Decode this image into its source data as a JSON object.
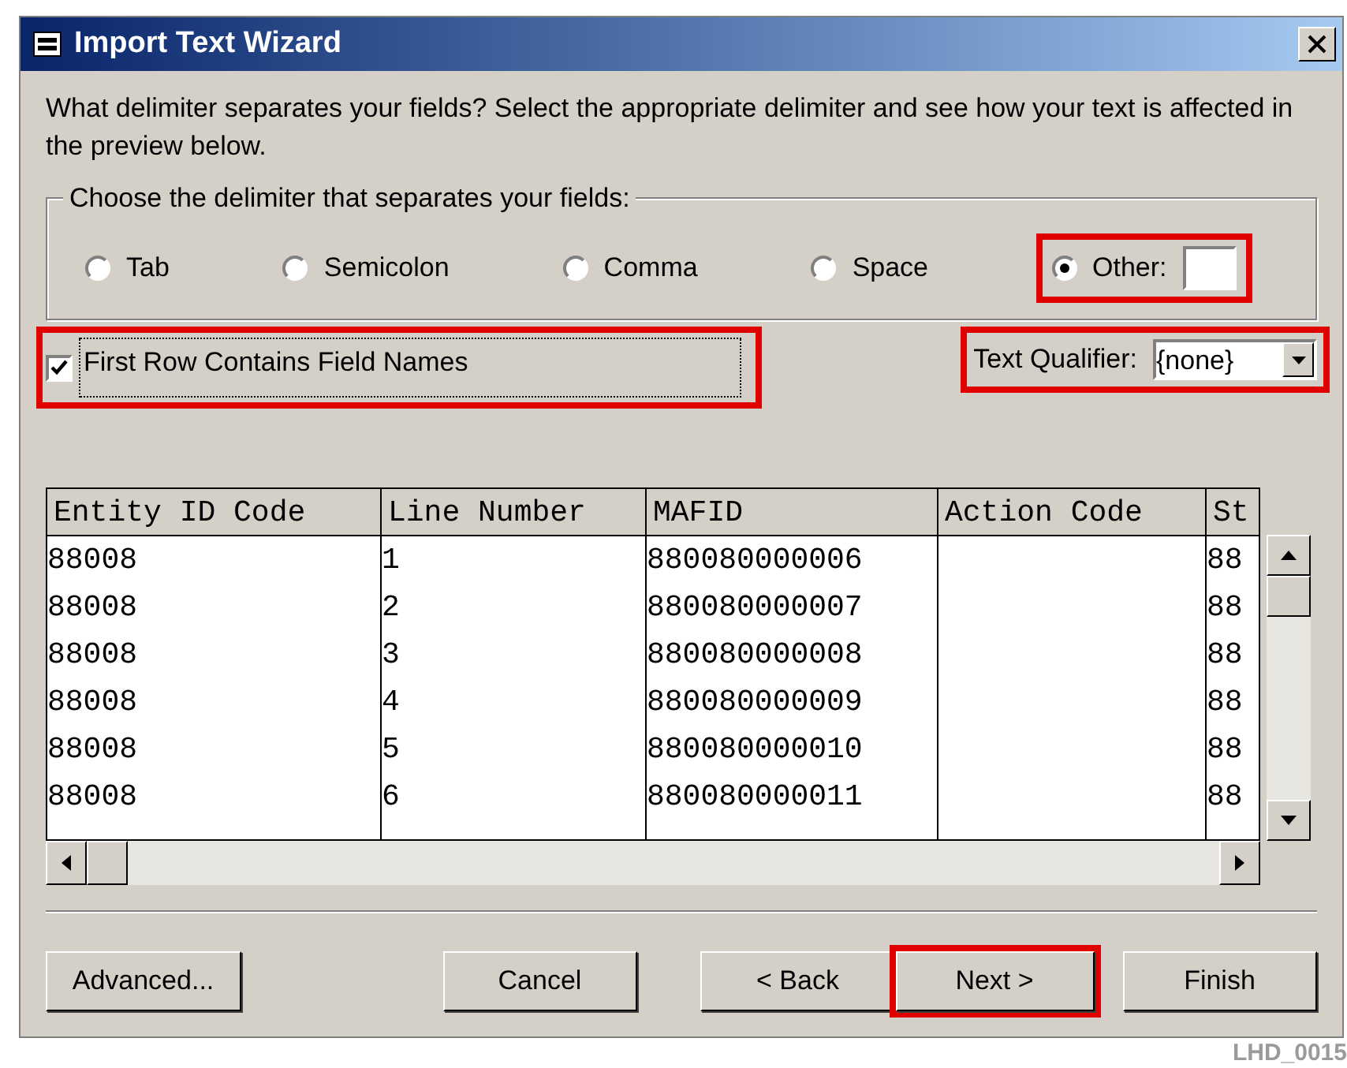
{
  "window": {
    "title": "Import Text Wizard"
  },
  "instructions": "What delimiter separates your fields? Select the appropriate delimiter and see how your text is affected in the preview below.",
  "delimiter_group": {
    "label": "Choose the delimiter that separates your fields:",
    "options": [
      {
        "label": "Tab",
        "selected": false,
        "highlighted": false
      },
      {
        "label": "Semicolon",
        "selected": false,
        "highlighted": false
      },
      {
        "label": "Comma",
        "selected": false,
        "highlighted": false
      },
      {
        "label": "Space",
        "selected": false,
        "highlighted": false
      },
      {
        "label": "Other:",
        "selected": true,
        "highlighted": true,
        "has_field": true
      }
    ]
  },
  "first_row_checkbox": {
    "label": "First Row Contains Field Names",
    "checked": true,
    "highlighted": true
  },
  "text_qualifier": {
    "label": "Text Qualifier:",
    "value": "{none}",
    "highlighted": true
  },
  "preview": {
    "columns": [
      "Entity ID Code",
      "Line Number",
      "MAFID",
      "Action Code",
      "St"
    ],
    "rows": [
      [
        "88008",
        "1",
        "880080000006",
        "",
        "88"
      ],
      [
        "88008",
        "2",
        "880080000007",
        "",
        "88"
      ],
      [
        "88008",
        "3",
        "880080000008",
        "",
        "88"
      ],
      [
        "88008",
        "4",
        "880080000009",
        "",
        "88"
      ],
      [
        "88008",
        "5",
        "880080000010",
        "",
        "88"
      ],
      [
        "88008",
        "6",
        "880080000011",
        "",
        "88"
      ]
    ]
  },
  "buttons": [
    {
      "label": "Advanced...",
      "highlighted": false
    },
    {
      "label": "Cancel",
      "highlighted": false
    },
    {
      "label": "< Back",
      "highlighted": false
    },
    {
      "label": "Next >",
      "highlighted": true
    },
    {
      "label": "Finish",
      "highlighted": false
    }
  ],
  "figure_id": "LHD_0015"
}
